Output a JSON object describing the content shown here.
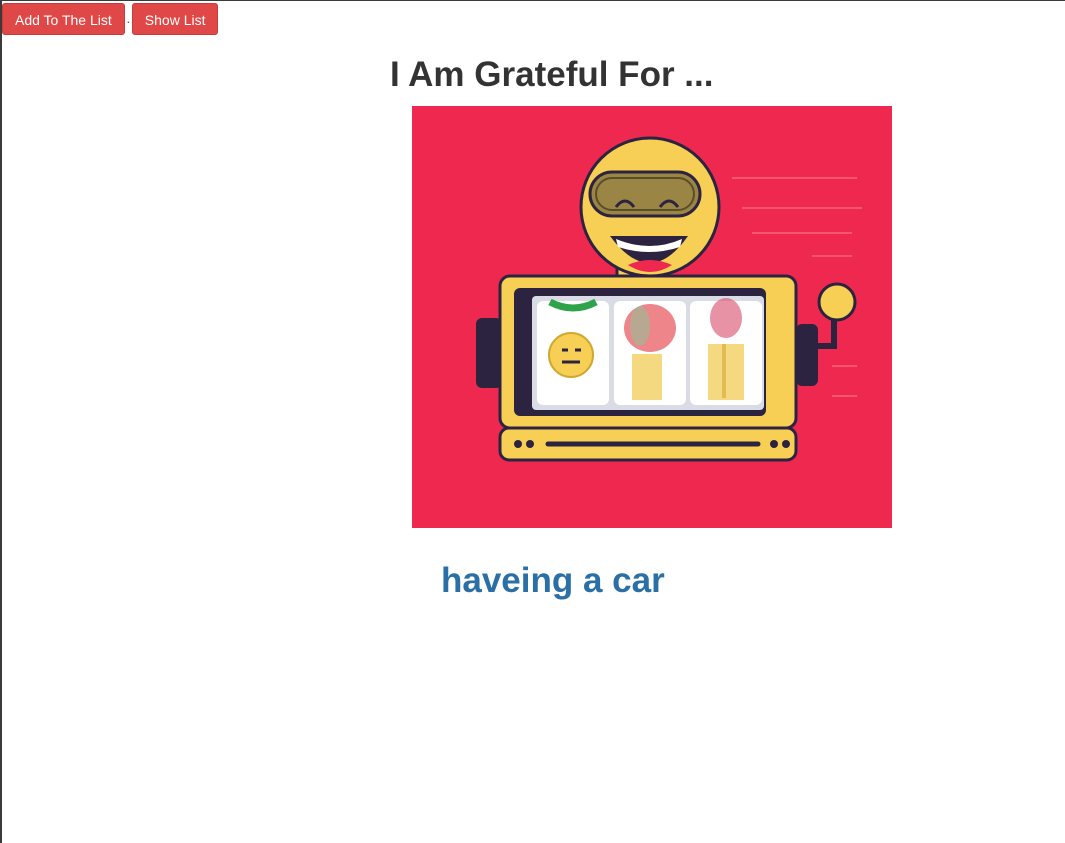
{
  "toolbar": {
    "add_label": "Add To The List",
    "separator": ".",
    "show_label": "Show List"
  },
  "page": {
    "title": "I Am Grateful For ..."
  },
  "hero": {
    "illustration": "slot-machine-robot-illustration",
    "background_color": "#ef2850"
  },
  "gratitude_item": {
    "text": "haveing a car"
  },
  "colors": {
    "button_bg": "#e04848",
    "title_text": "#333333",
    "item_text": "#2a6fa6"
  }
}
